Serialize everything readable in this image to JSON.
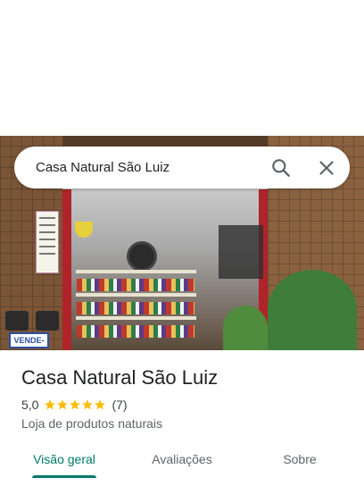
{
  "search": {
    "query": "Casa Natural São Luiz"
  },
  "photo": {
    "sign_text": "VENDE-SE"
  },
  "place": {
    "name": "Casa Natural São Luiz",
    "rating": "5,0",
    "stars": 5,
    "reviews": "(7)",
    "category": "Loja de produtos naturais"
  },
  "tabs": [
    {
      "label": "Visão geral",
      "active": true
    },
    {
      "label": "Avaliações",
      "active": false
    },
    {
      "label": "Sobre",
      "active": false
    }
  ],
  "colors": {
    "accent": "#00796b",
    "star": "#fbbc04"
  },
  "icons": {
    "search": "search-icon",
    "close": "close-icon",
    "star": "star-icon"
  }
}
